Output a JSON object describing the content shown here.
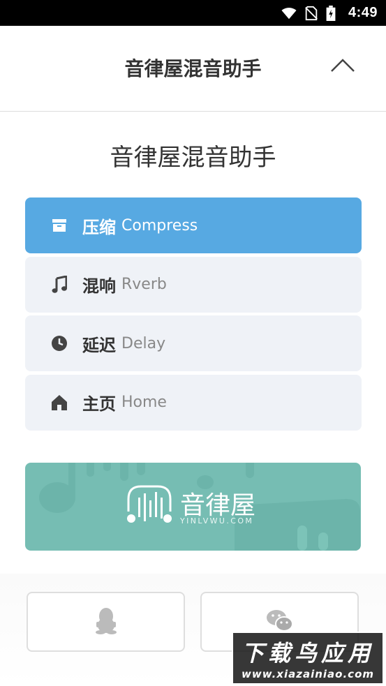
{
  "status_bar": {
    "time": "4:49",
    "icons": [
      "wifi-icon",
      "no-sim-icon",
      "battery-charging-icon"
    ]
  },
  "header": {
    "title": "音律屋混音助手",
    "collapse_icon": "chevron-up-icon"
  },
  "page": {
    "title": "音律屋混音助手"
  },
  "menu": {
    "items": [
      {
        "cn": "压缩",
        "en": "Compress",
        "icon": "archive-icon",
        "active": true
      },
      {
        "cn": "混响",
        "en": "Rverb",
        "icon": "music-note-icon",
        "active": false
      },
      {
        "cn": "延迟",
        "en": "Delay",
        "icon": "clock-icon",
        "active": false
      },
      {
        "cn": "主页",
        "en": "Home",
        "icon": "home-icon",
        "active": false
      }
    ]
  },
  "banner": {
    "logo_text": "音律屋",
    "logo_sub": "YINLVWU.COM"
  },
  "login": {
    "buttons": [
      {
        "icon": "qq-icon"
      },
      {
        "icon": "wechat-icon"
      }
    ]
  },
  "watermark": {
    "main": "下载鸟应用",
    "url": "www.xiazainiao.com"
  },
  "colors": {
    "active": "#57a9e2",
    "item_bg": "#eff2f7",
    "banner": "#76bdb3"
  }
}
